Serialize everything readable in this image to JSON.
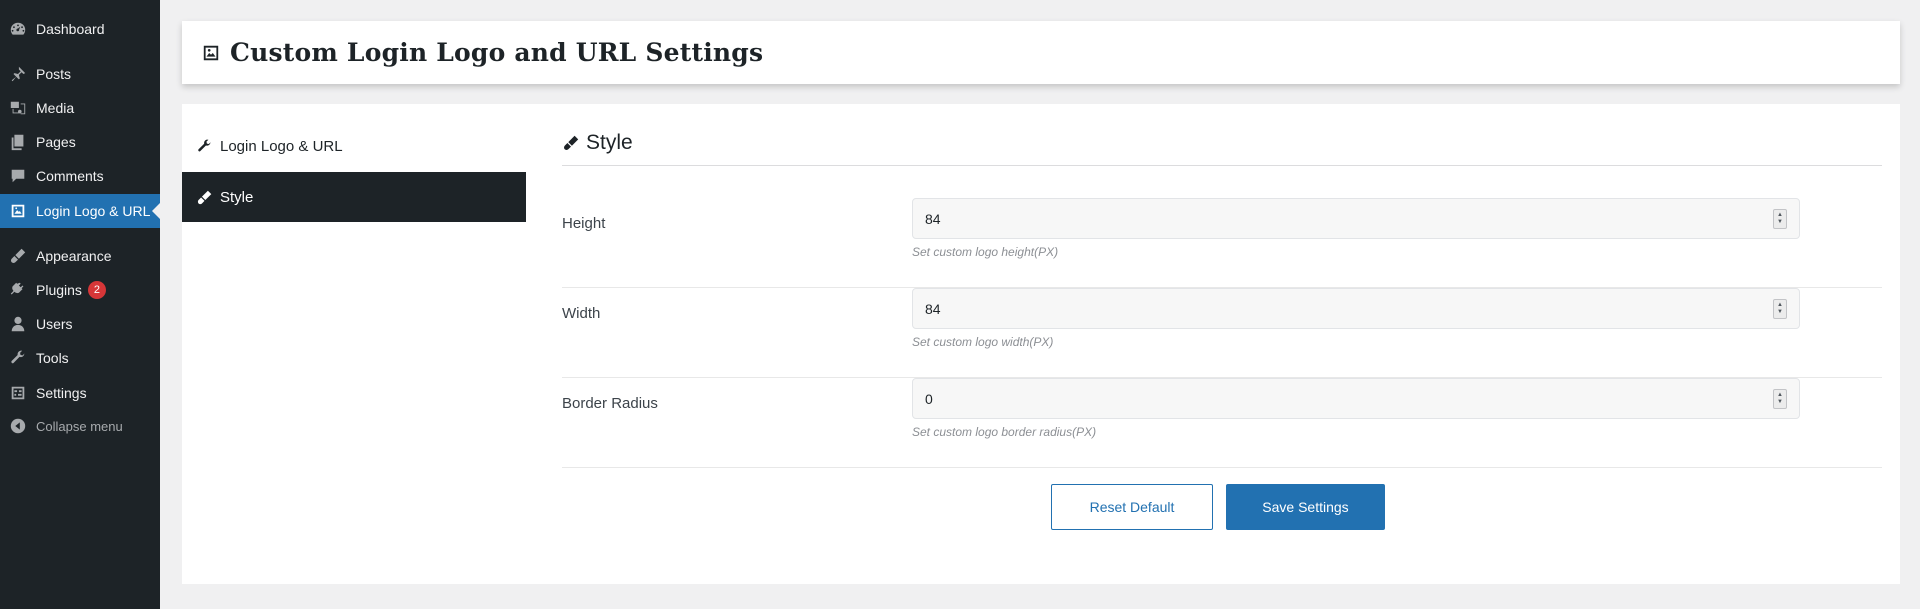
{
  "sidebar": {
    "items": [
      {
        "label": "Dashboard",
        "icon": "dashboard-icon"
      },
      {
        "label": "Posts",
        "icon": "pin-icon"
      },
      {
        "label": "Media",
        "icon": "media-icon"
      },
      {
        "label": "Pages",
        "icon": "pages-icon"
      },
      {
        "label": "Comments",
        "icon": "comment-icon"
      },
      {
        "label": "Login Logo & URL",
        "icon": "image-icon",
        "active": true
      },
      {
        "label": "Appearance",
        "icon": "brush-icon"
      },
      {
        "label": "Plugins",
        "icon": "plug-icon",
        "badge": "2"
      },
      {
        "label": "Users",
        "icon": "user-icon"
      },
      {
        "label": "Tools",
        "icon": "wrench-icon"
      },
      {
        "label": "Settings",
        "icon": "sliders-icon"
      }
    ],
    "collapse_label": "Collapse menu"
  },
  "header": {
    "title": "Custom Login Logo and URL Settings"
  },
  "tabs": [
    {
      "label": "Login Logo & URL",
      "icon": "wrench-icon"
    },
    {
      "label": "Style",
      "icon": "brush-icon",
      "active": true
    }
  ],
  "section": {
    "title": "Style"
  },
  "fields": [
    {
      "label": "Height",
      "value": "84",
      "hint": "Set custom logo height(PX)"
    },
    {
      "label": "Width",
      "value": "84",
      "hint": "Set custom logo width(PX)"
    },
    {
      "label": "Border Radius",
      "value": "0",
      "hint": "Set custom logo border radius(PX)"
    }
  ],
  "buttons": {
    "reset_label": "Reset Default",
    "save_label": "Save Settings"
  },
  "colors": {
    "sidebar_bg": "#1d2327",
    "accent": "#2271b1",
    "badge": "#d63638"
  }
}
